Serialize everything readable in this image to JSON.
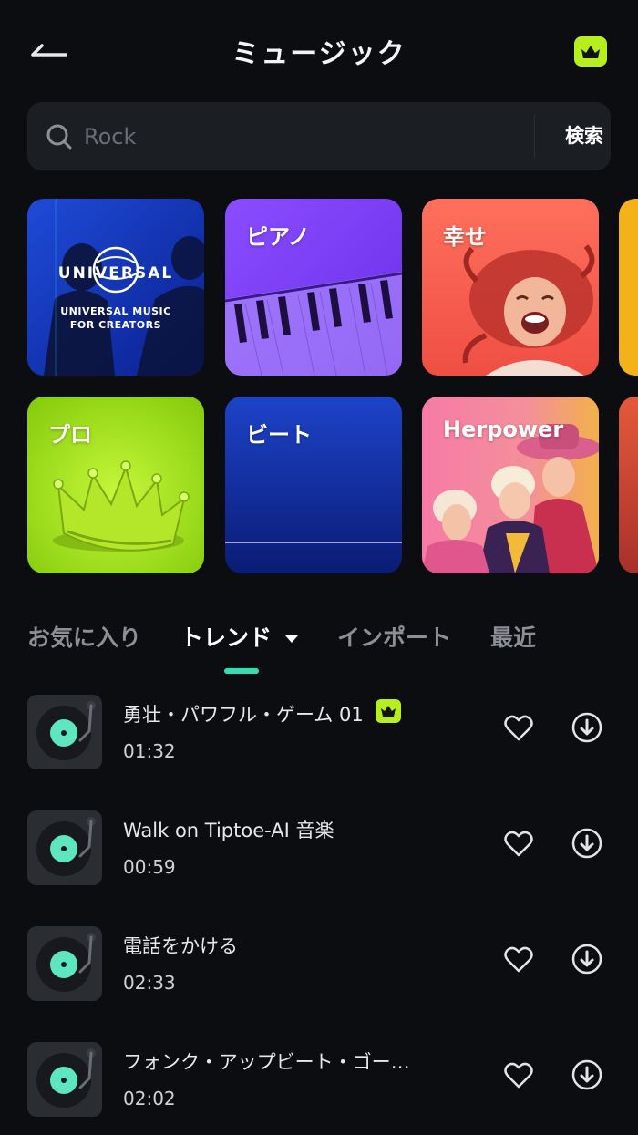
{
  "header": {
    "title": "ミュージック",
    "back_icon": "back-arrow-icon",
    "premium_icon": "crown-icon"
  },
  "search": {
    "placeholder": "Rock",
    "button_label": "検索"
  },
  "categories": [
    {
      "label": "",
      "logo_text": "UNIVERSAL",
      "sub_line1": "UNIVERSAL MUSIC",
      "sub_line2": "FOR CREATORS"
    },
    {
      "label": "ピアノ"
    },
    {
      "label": "幸せ"
    },
    {
      "label": "プロ"
    },
    {
      "label": "ビート"
    },
    {
      "label": "Herpower"
    }
  ],
  "tabs": [
    {
      "label": "お気に入り"
    },
    {
      "label": "トレンド",
      "active": true
    },
    {
      "label": "インポート"
    },
    {
      "label": "最近"
    }
  ],
  "tracks": [
    {
      "title": "勇壮・パワフル・ゲーム 01",
      "duration": "01:32",
      "premium": true
    },
    {
      "title": "Walk on Tiptoe-AI 音楽",
      "duration": "00:59",
      "premium": false
    },
    {
      "title": "電話をかける",
      "duration": "02:33",
      "premium": false
    },
    {
      "title": "フォンク・アップビート・ゴー…",
      "duration": "02:02",
      "premium": false
    }
  ],
  "colors": {
    "background": "#0b0d10",
    "accent": "#2ee0b4",
    "premium": "#b6ee1f",
    "disc": "#5ee6c1"
  }
}
